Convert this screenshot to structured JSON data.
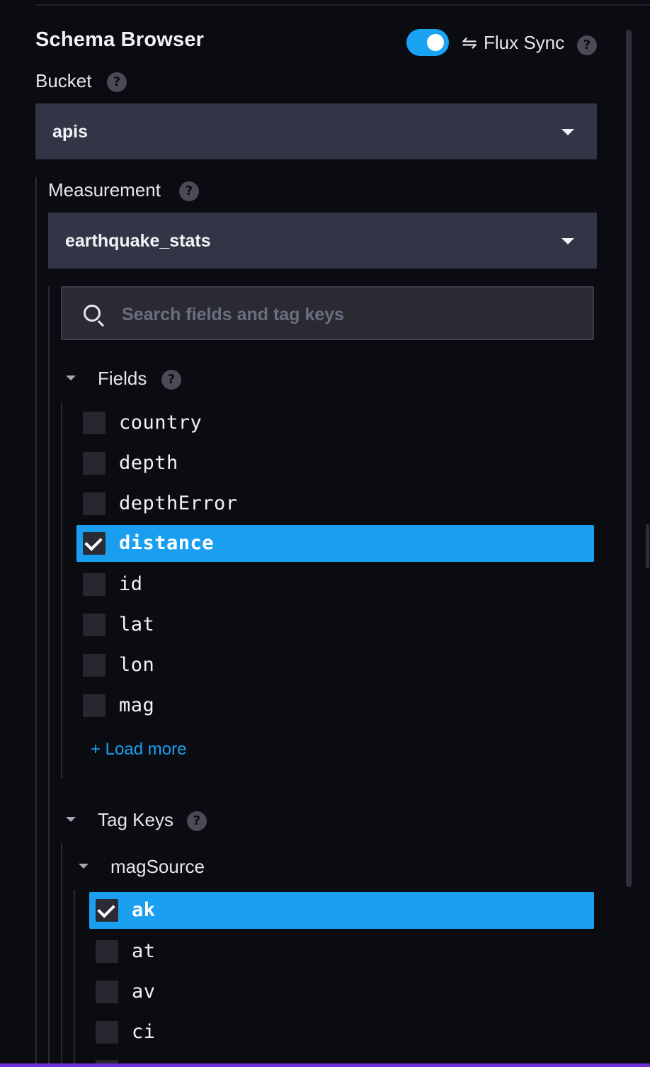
{
  "header": {
    "title": "Schema Browser",
    "flux_sync_label": "Flux Sync",
    "flux_sync_icon": "⇋",
    "flux_sync_enabled": true,
    "help_glyph": "?"
  },
  "bucket": {
    "label": "Bucket",
    "selected": "apis"
  },
  "measurement": {
    "label": "Measurement",
    "selected": "earthquake_stats"
  },
  "search": {
    "placeholder": "Search fields and tag keys",
    "value": ""
  },
  "fields": {
    "title": "Fields",
    "items": [
      {
        "label": "country",
        "checked": false
      },
      {
        "label": "depth",
        "checked": false
      },
      {
        "label": "depthError",
        "checked": false
      },
      {
        "label": "distance",
        "checked": true
      },
      {
        "label": "id",
        "checked": false
      },
      {
        "label": "lat",
        "checked": false
      },
      {
        "label": "lon",
        "checked": false
      },
      {
        "label": "mag",
        "checked": false
      }
    ],
    "load_more": "+ Load more"
  },
  "tag_keys": {
    "title": "Tag Keys",
    "groups": [
      {
        "name": "magSource",
        "values": [
          {
            "label": "ak",
            "checked": true
          },
          {
            "label": "at",
            "checked": false
          },
          {
            "label": "av",
            "checked": false
          },
          {
            "label": "ci",
            "checked": false
          }
        ]
      }
    ]
  },
  "colors": {
    "accent": "#1a9ff0",
    "background": "#0b0b12",
    "dropdown_bg": "#333446"
  }
}
